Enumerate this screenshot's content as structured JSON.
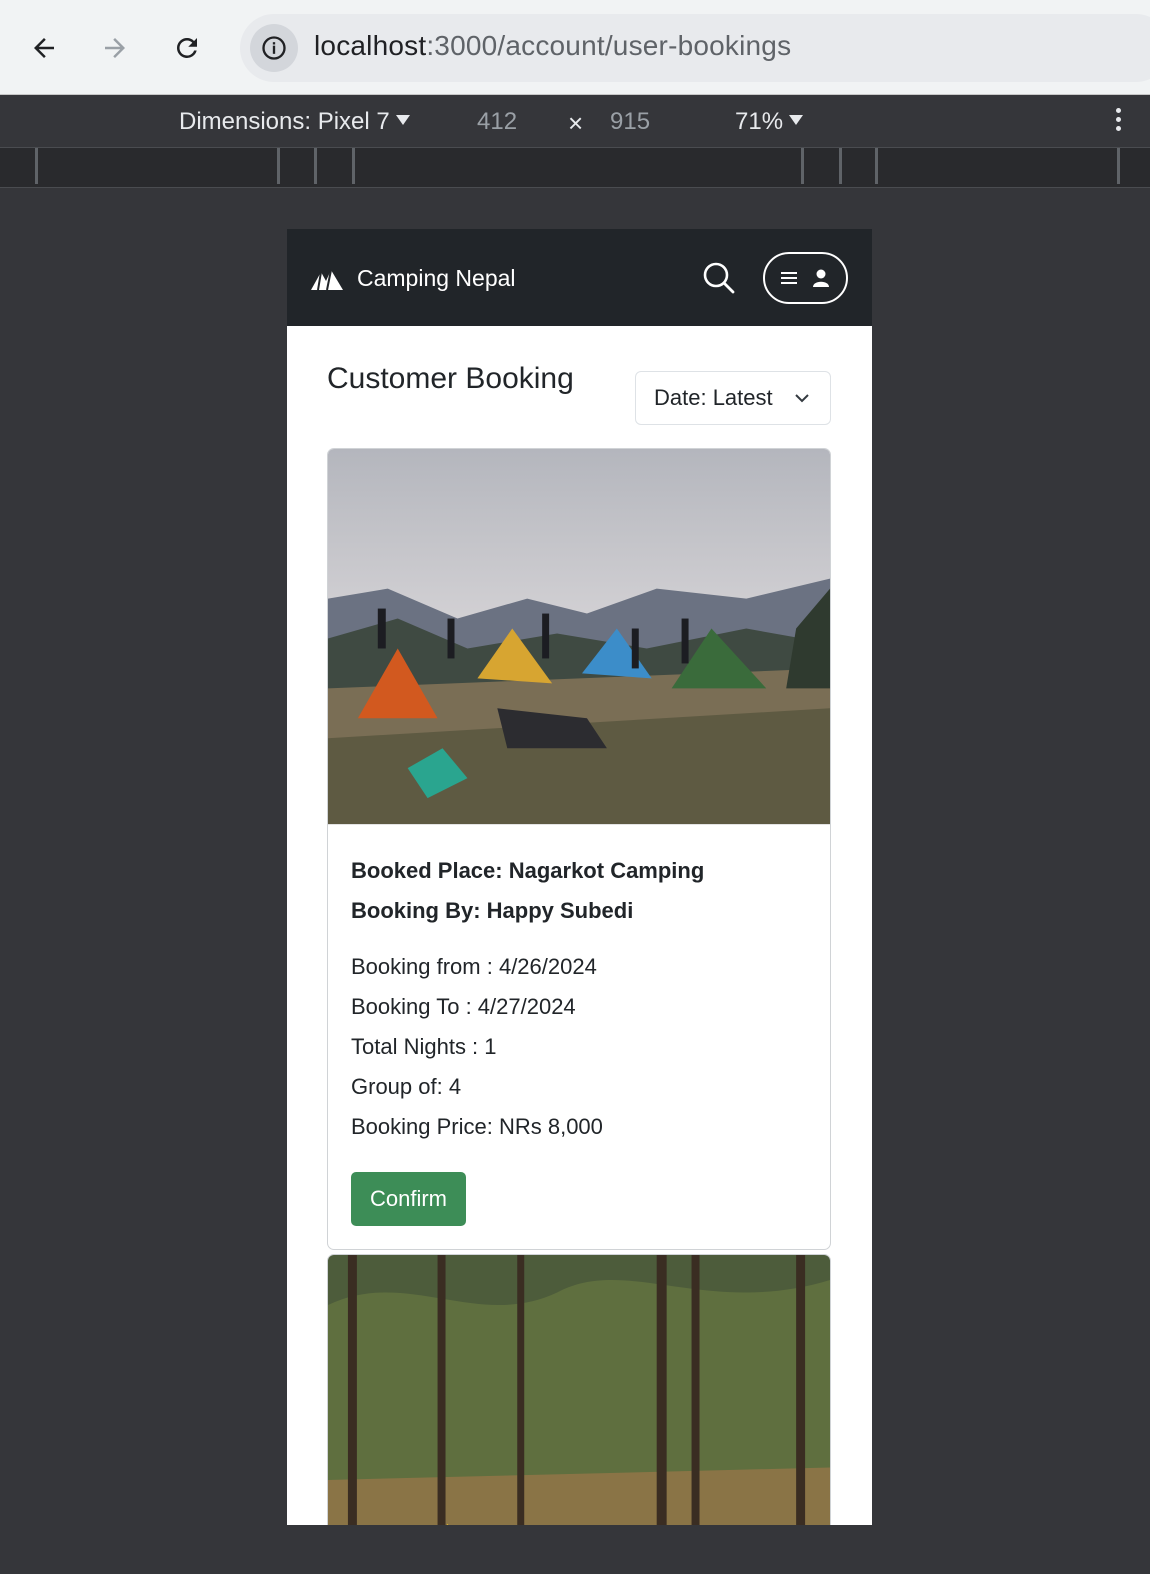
{
  "browser": {
    "url_host": "localhost",
    "url_path": ":3000/account/user-bookings"
  },
  "device_toolbar": {
    "dimensions_label": "Dimensions: Pixel 7",
    "width": "412",
    "times": "×",
    "height": "915",
    "zoom": "71%"
  },
  "app": {
    "brand": "Camping Nepal",
    "page_title": "Customer Booking",
    "sort": {
      "selected": "Date: Latest"
    }
  },
  "bookings": [
    {
      "place": "Booked Place: Nagarkot Camping",
      "by": "Booking By: Happy Subedi",
      "from": "Booking from : 4/26/2024",
      "to": "Booking To : 4/27/2024",
      "nights": "Total Nights : 1",
      "group": "Group of: 4",
      "price": "Booking Price: NRs 8,000",
      "action": "Confirm"
    }
  ],
  "colors": {
    "navbar": "#212529",
    "confirm": "#3d8d57"
  }
}
